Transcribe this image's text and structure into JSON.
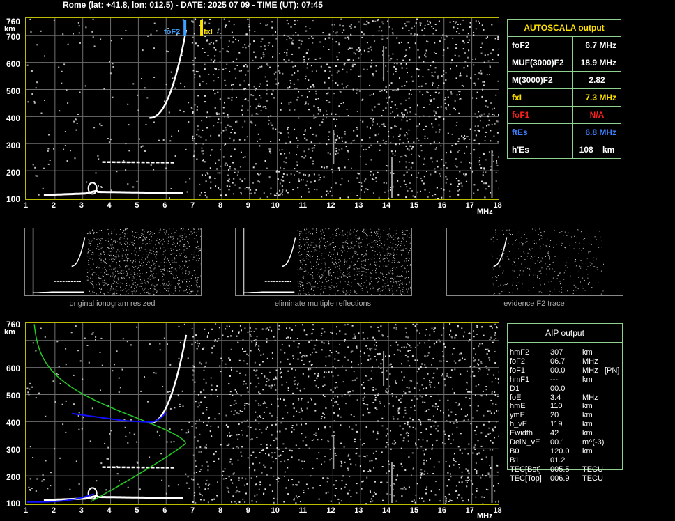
{
  "header": "Rome (lat: +41.8, lon: 012.5) - DATE: 2025 07 09 - TIME (UT): 07:45",
  "axes": {
    "y_ticks": [
      "760",
      "700",
      "600",
      "500",
      "400",
      "300",
      "200",
      "100"
    ],
    "y_unit": "km",
    "x_ticks": [
      "1",
      "2",
      "3",
      "4",
      "5",
      "6",
      "7",
      "8",
      "9",
      "10",
      "11",
      "12",
      "13",
      "14",
      "15",
      "16",
      "17",
      "18"
    ],
    "x_unit": "MHz"
  },
  "markers": {
    "fof2": "foF2",
    "fxi": "fxI"
  },
  "colors": {
    "frame": "#bcbc00",
    "grid": "#6e6e6e",
    "table_border": "#8fd28f",
    "fof2": "#3fa0ff",
    "fxi": "#ffe100",
    "fof1": "#ff2020",
    "ftes": "#3f80ff",
    "profile": "#22cc22",
    "blue_trace": "#1010ff"
  },
  "autoscala": {
    "title": "AUTOSCALA output",
    "rows": [
      {
        "label": "foF2",
        "value": "6.7 MHz",
        "color": "#ffffff"
      },
      {
        "label": "MUF(3000)F2",
        "value": "18.9 MHz",
        "color": "#ffffff"
      },
      {
        "label": "M(3000)F2",
        "value": "2.82",
        "color": "#ffffff"
      },
      {
        "label": "fxI",
        "value": "7.3 MHz",
        "color": "#ffe100"
      },
      {
        "label": "foF1",
        "value": "N/A",
        "color": "#ff2020"
      },
      {
        "label": "ftEs",
        "value": "6.8 MHz",
        "color": "#3f80ff"
      },
      {
        "label": "h'Es",
        "value": "108    km",
        "color": "#ffffff"
      }
    ]
  },
  "thumbnails": [
    {
      "caption": "original ionogram resized"
    },
    {
      "caption": "eliminate multiple reflections"
    },
    {
      "caption": "evidence F2 trace"
    }
  ],
  "aip": {
    "title": "AIP output",
    "rows": [
      {
        "name": "hmF2",
        "val": "307",
        "unit": "km",
        "extra": ""
      },
      {
        "name": "foF2",
        "val": "06.7",
        "unit": "MHz",
        "extra": ""
      },
      {
        "name": "foF1",
        "val": "00.0",
        "unit": "MHz",
        "extra": "[PN]"
      },
      {
        "name": "hmF1",
        "val": "---",
        "unit": "km",
        "extra": ""
      },
      {
        "name": "D1",
        "val": "00.0",
        "unit": "",
        "extra": ""
      },
      {
        "name": "foE",
        "val": "3.4",
        "unit": "MHz",
        "extra": ""
      },
      {
        "name": "hmE",
        "val": "110",
        "unit": "km",
        "extra": ""
      },
      {
        "name": "ymE",
        "val": "20",
        "unit": "km",
        "extra": ""
      },
      {
        "name": "h_vE",
        "val": "119",
        "unit": "km",
        "extra": ""
      },
      {
        "name": "Ewidth",
        "val": "42",
        "unit": "km",
        "extra": ""
      },
      {
        "name": "DelN_vE",
        "val": "00.1",
        "unit": "m^(-3)",
        "extra": ""
      },
      {
        "name": "B0",
        "val": "120.0",
        "unit": "km",
        "extra": ""
      },
      {
        "name": "B1",
        "val": "01.2",
        "unit": "",
        "extra": ""
      },
      {
        "name": "TEC[Bot]",
        "val": "005.5",
        "unit": "TECU",
        "extra": ""
      },
      {
        "name": "TEC[Top]",
        "val": "006.9",
        "unit": "TECU",
        "extra": ""
      }
    ]
  }
}
